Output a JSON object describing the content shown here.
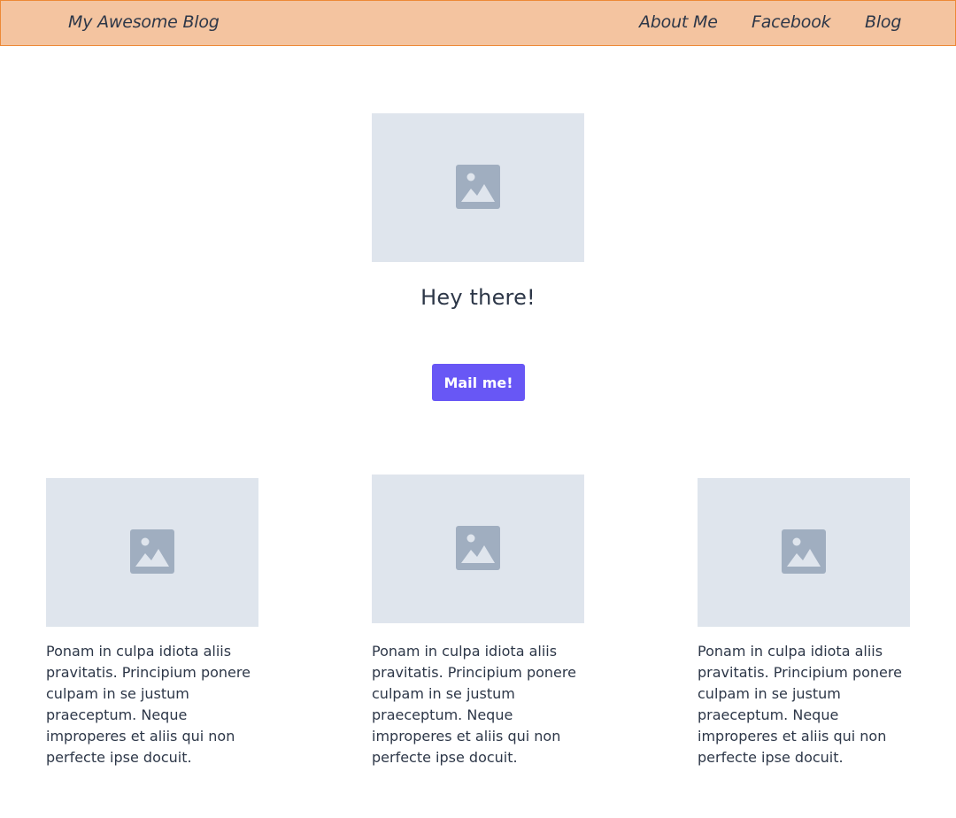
{
  "navbar": {
    "brand": "My Awesome Blog",
    "links": [
      {
        "label": "About Me"
      },
      {
        "label": "Facebook"
      },
      {
        "label": "Blog"
      }
    ]
  },
  "hero": {
    "image_icon": "image-placeholder-icon",
    "title": "Hey there!",
    "button_label": "Mail me!"
  },
  "cards": [
    {
      "image_icon": "image-placeholder-icon",
      "text": "Ponam in culpa idiota aliis pravitatis. Principium ponere culpam in se justum praeceptum. Neque improperes et aliis qui non perfecte ipse docuit."
    },
    {
      "image_icon": "image-placeholder-icon",
      "text": "Ponam in culpa idiota aliis pravitatis. Principium ponere culpam in se justum praeceptum. Neque improperes et aliis qui non perfecte ipse docuit."
    },
    {
      "image_icon": "image-placeholder-icon",
      "text": "Ponam in culpa idiota aliis pravitatis. Principium ponere culpam in se justum praeceptum. Neque improperes et aliis qui non perfecte ipse docuit."
    }
  ],
  "colors": {
    "navbar_bg": "#f4c4a0",
    "navbar_border": "#ed8936",
    "accent": "#6857f5",
    "placeholder_bg": "#dfe5ed",
    "placeholder_icon": "#a0aec0",
    "text": "#2d3748"
  }
}
